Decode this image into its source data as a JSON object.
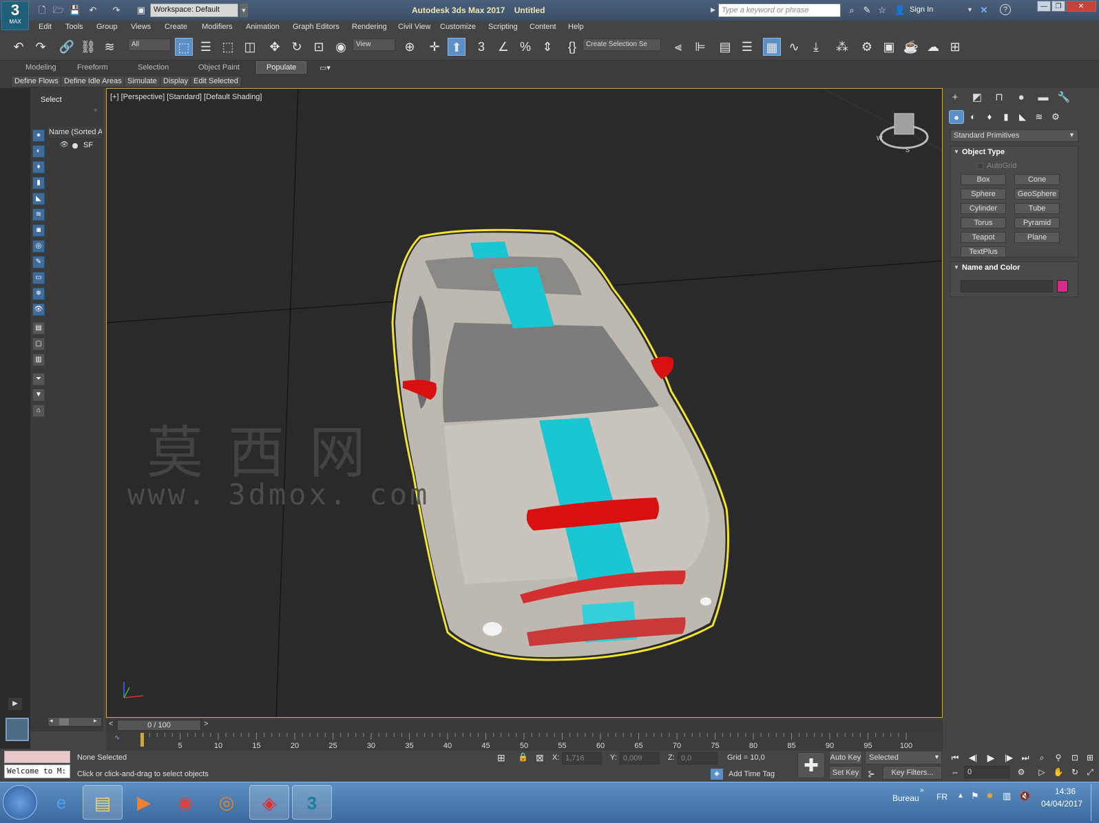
{
  "app": {
    "title": "Autodesk 3ds Max 2017",
    "document": "Untitled",
    "logo_main": "3",
    "logo_sub": "MAX",
    "workspace": "Workspace: Default",
    "search_placeholder": "Type a keyword or phrase",
    "sign_in": "Sign In"
  },
  "menu": [
    "Edit",
    "Tools",
    "Group",
    "Views",
    "Create",
    "Modifiers",
    "Animation",
    "Graph Editors",
    "Rendering",
    "Civil View",
    "Customize",
    "Scripting",
    "Content",
    "Help"
  ],
  "toolbar": {
    "filter": "All",
    "ref_coord": "View",
    "selection_set": "Create Selection Se"
  },
  "ribbon": {
    "tabs": [
      "Modeling",
      "Freeform",
      "Selection",
      "Object Paint",
      "Populate"
    ],
    "active": "Populate",
    "subtabs": [
      "Define Flows",
      "Define Idle Areas",
      "Simulate",
      "Display",
      "Edit Selected"
    ]
  },
  "scene_explorer": {
    "header": "Select",
    "column": "Name (Sorted A",
    "items": [
      {
        "name": "SF"
      }
    ]
  },
  "viewport": {
    "label": "[+] [Perspective] [Standard] [Default Shading]",
    "watermark_cn": "莫西网",
    "watermark_url": "www. 3dmox. com",
    "viewcube": [
      "W",
      "S"
    ]
  },
  "command_panel": {
    "category": "Standard Primitives",
    "object_type_title": "Object Type",
    "autogrid": "AutoGrid",
    "primitives": [
      "Box",
      "Cone",
      "Sphere",
      "GeoSphere",
      "Cylinder",
      "Tube",
      "Torus",
      "Pyramid",
      "Teapot",
      "Plane",
      "TextPlus"
    ],
    "name_color_title": "Name and Color",
    "object_name": "",
    "color": "#d82a8a"
  },
  "timeline": {
    "position": "0 / 100",
    "current_frame": 0,
    "ticks": [
      5,
      10,
      15,
      20,
      25,
      30,
      35,
      40,
      45,
      50,
      55,
      60,
      65,
      70,
      75,
      80,
      85,
      90,
      95,
      100
    ]
  },
  "status": {
    "script_listener": "Welcome to M:",
    "selection": "None Selected",
    "prompt": "Click or click-and-drag to select objects",
    "x_label": "X:",
    "x_value": "1,716",
    "y_label": "Y:",
    "y_value": "0,009",
    "z_label": "Z:",
    "z_value": "0,0",
    "grid": "Grid = 10,0",
    "add_time_tag": "Add Time Tag",
    "auto_key": "Auto Key",
    "set_key": "Set Key",
    "key_mode": "Selected",
    "key_filters": "Key Filters...",
    "frame_value": "0"
  },
  "taskbar": {
    "desktop": "Bureau",
    "lang": "FR",
    "time": "14:36",
    "date": "04/04/2017"
  },
  "colors": {
    "accent": "#5b8fc7",
    "viewport_border": "#c9a64a",
    "selection_outline": "#f2e52a",
    "stripe": "#19c6d2",
    "car_body": "#bdb8b0"
  }
}
